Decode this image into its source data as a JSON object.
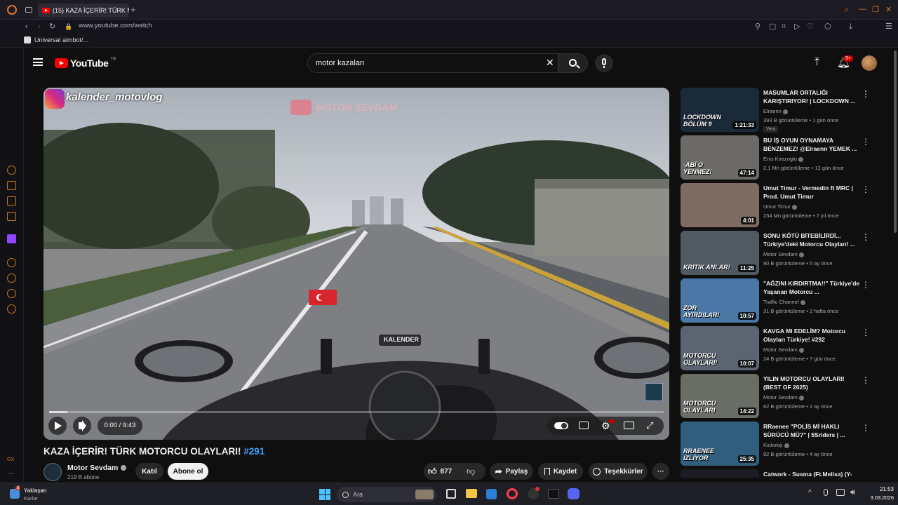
{
  "browser": {
    "tab_title": "(15) KAZA İÇERİR! TÜRK M",
    "url": "www.youtube.com/watch",
    "bookmark": "Universal aimbot/...",
    "ai_label": "AI"
  },
  "youtube": {
    "logo_text": "YouTube",
    "country": "TR",
    "search_value": "motor kazaları",
    "notification_count": "9+"
  },
  "player": {
    "overlay_handle": "kalender_motovlog",
    "overlay_channel": "MOTOR SEVDAM",
    "fairing_text": "KALENDER",
    "time": "0:00 / 9:43",
    "progress": 0.03
  },
  "video": {
    "title_main": "KAZA İÇERİR! TÜRK MOTORCU OLAYLARI! ",
    "title_tag": "#291",
    "channel": "Motor Sevdam",
    "subscribers": "219 B abone",
    "join_label": "Katıl",
    "subscribe_label": "Abone ol",
    "likes": "877",
    "share_label": "Paylaş",
    "save_label": "Kaydet",
    "thanks_label": "Teşekkürler"
  },
  "recommendations": [
    {
      "title": "MASUMLAR ORTALIĞI KARIŞTIRIYOR! | LOCKDOWN ...",
      "channel": "Elraenn",
      "stats": "393 B görüntüleme • 1 gün önce",
      "duration": "1:21:33",
      "badge": "Yeni",
      "thumb_text": "LOCKDOWN BÖLÜM 9",
      "bg": "#1b2a38"
    },
    {
      "title": "BU İŞ OYUN OYNAMAYA BENZEMEZ! @Elraenn YEMEK ...",
      "channel": "Enis Kirazoglu",
      "stats": "2,1 Mn görüntüleme • 12 gün önce",
      "duration": "47:14",
      "thumb_text": "-ABİ O YENMEZ!",
      "bg": "#6b6a66"
    },
    {
      "title": "Umut Timur - Vermedin ft MRC | Prod. Umut Timur",
      "channel": "Umut Timur",
      "stats": "234 Mn görüntüleme • 7 yıl önce",
      "duration": "4:01",
      "thumb_text": "",
      "bg": "#7e6c62"
    },
    {
      "title": "SONU KÖTÜ BİTEBİLİRDİ... Türkiye'deki Motorcu Olayları! ...",
      "channel": "Motor Sevdam",
      "stats": "90 B görüntüleme • 5 ay önce",
      "duration": "11:25",
      "thumb_text": "KRİTİK ANLAR!",
      "bg": "#505a63"
    },
    {
      "title": "\"AĞZINI KIRDIRTMA!!\" Türkiye'de Yaşanan Motorcu ...",
      "channel": "Traffic Channel",
      "stats": "31 B görüntüleme • 2 hafta önce",
      "duration": "10:57",
      "thumb_text": "ZOR AYIRDILAR!",
      "bg": "#4b77a6"
    },
    {
      "title": "KAVGA MI EDELİM? Motorcu Olayları Türkiye! #292",
      "channel": "Motor Sevdam",
      "stats": "24 B görüntüleme • 7 gün önce",
      "duration": "10:07",
      "thumb_text": "MOTORCU OLAYLARI!",
      "bg": "#5b6470"
    },
    {
      "title": "YILIN MOTORCU OLAYLARI! (BEST OF 2025)",
      "channel": "Motor Sevdam",
      "stats": "62 B görüntüleme • 2 ay önce",
      "duration": "14:22",
      "thumb_text": "MOTORCU OLAYLARI",
      "bg": "#6a6d66"
    },
    {
      "title": "RRaenee \"POLİS Mİ HAKLI SÜRÜCÜ MÜ?\" | 5Sriders | ...",
      "channel": "Kickoloji",
      "stats": "92 B görüntüleme • 4 ay önce",
      "duration": "25:35",
      "thumb_text": "RRAENEE İZLİYOR",
      "bg": "#2f5f7d"
    },
    {
      "title": "Catwork - Susma (Ft.Melisa) (Y-",
      "channel": "",
      "stats": "",
      "duration": "",
      "thumb_text": "",
      "bg": "#1c1c24"
    }
  ],
  "taskbar": {
    "weather_title": "Yaklaşan",
    "weather_sub": "Karlar",
    "weather_badge": "3",
    "search_placeholder": "Ara",
    "time": "21:53",
    "date": "3.03.2026"
  }
}
